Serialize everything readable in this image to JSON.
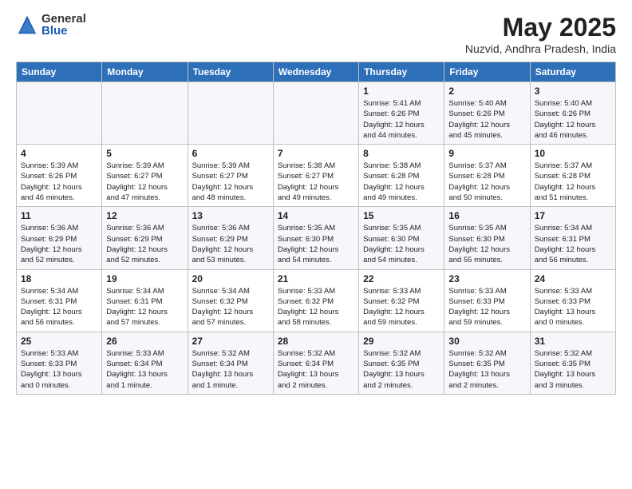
{
  "logo": {
    "general": "General",
    "blue": "Blue"
  },
  "title": "May 2025",
  "subtitle": "Nuzvid, Andhra Pradesh, India",
  "headers": [
    "Sunday",
    "Monday",
    "Tuesday",
    "Wednesday",
    "Thursday",
    "Friday",
    "Saturday"
  ],
  "rows": [
    [
      {
        "day": "",
        "lines": []
      },
      {
        "day": "",
        "lines": []
      },
      {
        "day": "",
        "lines": []
      },
      {
        "day": "",
        "lines": []
      },
      {
        "day": "1",
        "lines": [
          "Sunrise: 5:41 AM",
          "Sunset: 6:26 PM",
          "Daylight: 12 hours",
          "and 44 minutes."
        ]
      },
      {
        "day": "2",
        "lines": [
          "Sunrise: 5:40 AM",
          "Sunset: 6:26 PM",
          "Daylight: 12 hours",
          "and 45 minutes."
        ]
      },
      {
        "day": "3",
        "lines": [
          "Sunrise: 5:40 AM",
          "Sunset: 6:26 PM",
          "Daylight: 12 hours",
          "and 46 minutes."
        ]
      }
    ],
    [
      {
        "day": "4",
        "lines": [
          "Sunrise: 5:39 AM",
          "Sunset: 6:26 PM",
          "Daylight: 12 hours",
          "and 46 minutes."
        ]
      },
      {
        "day": "5",
        "lines": [
          "Sunrise: 5:39 AM",
          "Sunset: 6:27 PM",
          "Daylight: 12 hours",
          "and 47 minutes."
        ]
      },
      {
        "day": "6",
        "lines": [
          "Sunrise: 5:39 AM",
          "Sunset: 6:27 PM",
          "Daylight: 12 hours",
          "and 48 minutes."
        ]
      },
      {
        "day": "7",
        "lines": [
          "Sunrise: 5:38 AM",
          "Sunset: 6:27 PM",
          "Daylight: 12 hours",
          "and 49 minutes."
        ]
      },
      {
        "day": "8",
        "lines": [
          "Sunrise: 5:38 AM",
          "Sunset: 6:28 PM",
          "Daylight: 12 hours",
          "and 49 minutes."
        ]
      },
      {
        "day": "9",
        "lines": [
          "Sunrise: 5:37 AM",
          "Sunset: 6:28 PM",
          "Daylight: 12 hours",
          "and 50 minutes."
        ]
      },
      {
        "day": "10",
        "lines": [
          "Sunrise: 5:37 AM",
          "Sunset: 6:28 PM",
          "Daylight: 12 hours",
          "and 51 minutes."
        ]
      }
    ],
    [
      {
        "day": "11",
        "lines": [
          "Sunrise: 5:36 AM",
          "Sunset: 6:29 PM",
          "Daylight: 12 hours",
          "and 52 minutes."
        ]
      },
      {
        "day": "12",
        "lines": [
          "Sunrise: 5:36 AM",
          "Sunset: 6:29 PM",
          "Daylight: 12 hours",
          "and 52 minutes."
        ]
      },
      {
        "day": "13",
        "lines": [
          "Sunrise: 5:36 AM",
          "Sunset: 6:29 PM",
          "Daylight: 12 hours",
          "and 53 minutes."
        ]
      },
      {
        "day": "14",
        "lines": [
          "Sunrise: 5:35 AM",
          "Sunset: 6:30 PM",
          "Daylight: 12 hours",
          "and 54 minutes."
        ]
      },
      {
        "day": "15",
        "lines": [
          "Sunrise: 5:35 AM",
          "Sunset: 6:30 PM",
          "Daylight: 12 hours",
          "and 54 minutes."
        ]
      },
      {
        "day": "16",
        "lines": [
          "Sunrise: 5:35 AM",
          "Sunset: 6:30 PM",
          "Daylight: 12 hours",
          "and 55 minutes."
        ]
      },
      {
        "day": "17",
        "lines": [
          "Sunrise: 5:34 AM",
          "Sunset: 6:31 PM",
          "Daylight: 12 hours",
          "and 56 minutes."
        ]
      }
    ],
    [
      {
        "day": "18",
        "lines": [
          "Sunrise: 5:34 AM",
          "Sunset: 6:31 PM",
          "Daylight: 12 hours",
          "and 56 minutes."
        ]
      },
      {
        "day": "19",
        "lines": [
          "Sunrise: 5:34 AM",
          "Sunset: 6:31 PM",
          "Daylight: 12 hours",
          "and 57 minutes."
        ]
      },
      {
        "day": "20",
        "lines": [
          "Sunrise: 5:34 AM",
          "Sunset: 6:32 PM",
          "Daylight: 12 hours",
          "and 57 minutes."
        ]
      },
      {
        "day": "21",
        "lines": [
          "Sunrise: 5:33 AM",
          "Sunset: 6:32 PM",
          "Daylight: 12 hours",
          "and 58 minutes."
        ]
      },
      {
        "day": "22",
        "lines": [
          "Sunrise: 5:33 AM",
          "Sunset: 6:32 PM",
          "Daylight: 12 hours",
          "and 59 minutes."
        ]
      },
      {
        "day": "23",
        "lines": [
          "Sunrise: 5:33 AM",
          "Sunset: 6:33 PM",
          "Daylight: 12 hours",
          "and 59 minutes."
        ]
      },
      {
        "day": "24",
        "lines": [
          "Sunrise: 5:33 AM",
          "Sunset: 6:33 PM",
          "Daylight: 13 hours",
          "and 0 minutes."
        ]
      }
    ],
    [
      {
        "day": "25",
        "lines": [
          "Sunrise: 5:33 AM",
          "Sunset: 6:33 PM",
          "Daylight: 13 hours",
          "and 0 minutes."
        ]
      },
      {
        "day": "26",
        "lines": [
          "Sunrise: 5:33 AM",
          "Sunset: 6:34 PM",
          "Daylight: 13 hours",
          "and 1 minute."
        ]
      },
      {
        "day": "27",
        "lines": [
          "Sunrise: 5:32 AM",
          "Sunset: 6:34 PM",
          "Daylight: 13 hours",
          "and 1 minute."
        ]
      },
      {
        "day": "28",
        "lines": [
          "Sunrise: 5:32 AM",
          "Sunset: 6:34 PM",
          "Daylight: 13 hours",
          "and 2 minutes."
        ]
      },
      {
        "day": "29",
        "lines": [
          "Sunrise: 5:32 AM",
          "Sunset: 6:35 PM",
          "Daylight: 13 hours",
          "and 2 minutes."
        ]
      },
      {
        "day": "30",
        "lines": [
          "Sunrise: 5:32 AM",
          "Sunset: 6:35 PM",
          "Daylight: 13 hours",
          "and 2 minutes."
        ]
      },
      {
        "day": "31",
        "lines": [
          "Sunrise: 5:32 AM",
          "Sunset: 6:35 PM",
          "Daylight: 13 hours",
          "and 3 minutes."
        ]
      }
    ]
  ]
}
